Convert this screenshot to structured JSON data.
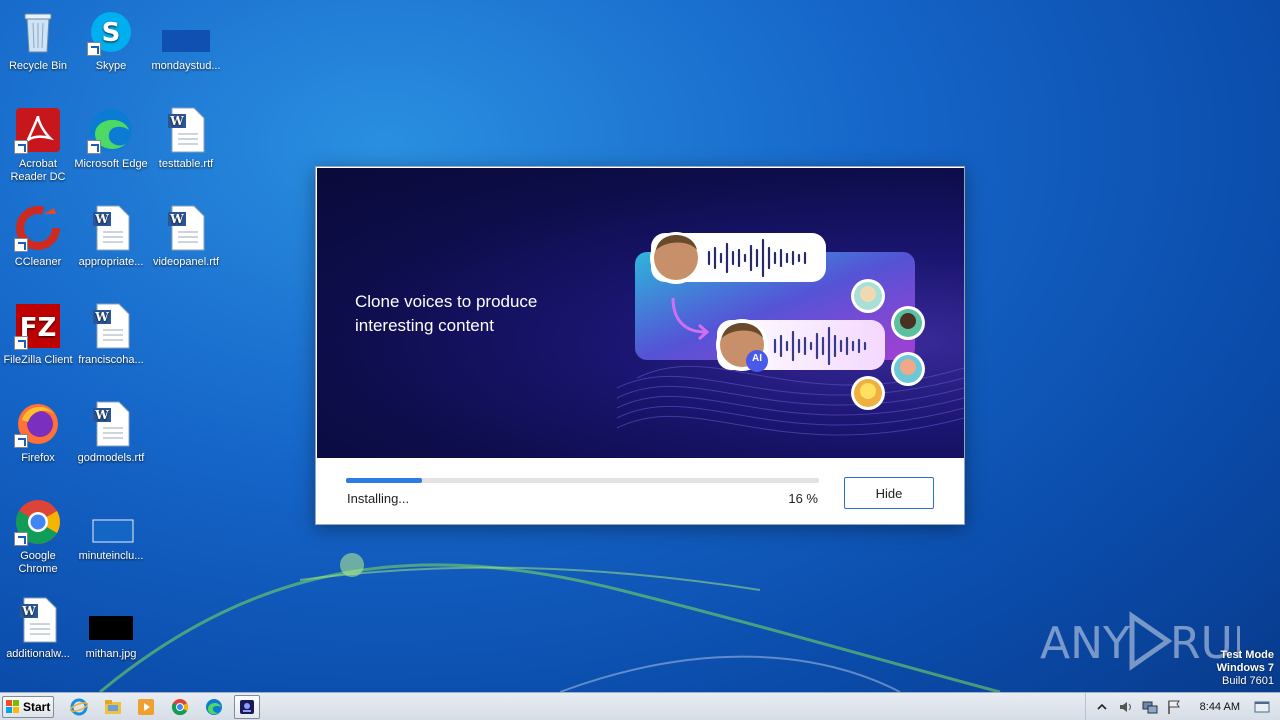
{
  "desktop": {
    "icons": [
      {
        "label": "Recycle Bin"
      },
      {
        "label": "Skype"
      },
      {
        "label": "mondaystud..."
      },
      {
        "label": "Acrobat Reader DC"
      },
      {
        "label": "Microsoft Edge"
      },
      {
        "label": "testtable.rtf"
      },
      {
        "label": "CCleaner"
      },
      {
        "label": "appropriate..."
      },
      {
        "label": "videopanel.rtf"
      },
      {
        "label": "FileZilla Client"
      },
      {
        "label": "franciscoha..."
      },
      {
        "label": "Firefox"
      },
      {
        "label": "godmodels.rtf"
      },
      {
        "label": "Google Chrome"
      },
      {
        "label": "minuteinclu..."
      },
      {
        "label": "additionalw..."
      },
      {
        "label": "mithan.jpg"
      }
    ],
    "watermark": {
      "line1": "Test Mode",
      "line2": "Windows 7",
      "line3": "Build 7601",
      "brand": "ANY RUN"
    }
  },
  "installer": {
    "banner_title": "Clone voices to produce interesting content",
    "ai_badge": "AI",
    "progress_percent": 16,
    "status_label": "Installing...",
    "percent_label": "16 %",
    "hide_label": "Hide",
    "colors": {
      "accent": "#2f7be5",
      "banner_bg": "#0d0d4a"
    }
  },
  "taskbar": {
    "start_label": "Start",
    "clock": "8:44 AM",
    "tray_icons": [
      "chevron-up-icon",
      "volume-icon",
      "network-icon",
      "flag-icon",
      "show-desktop-icon"
    ]
  }
}
